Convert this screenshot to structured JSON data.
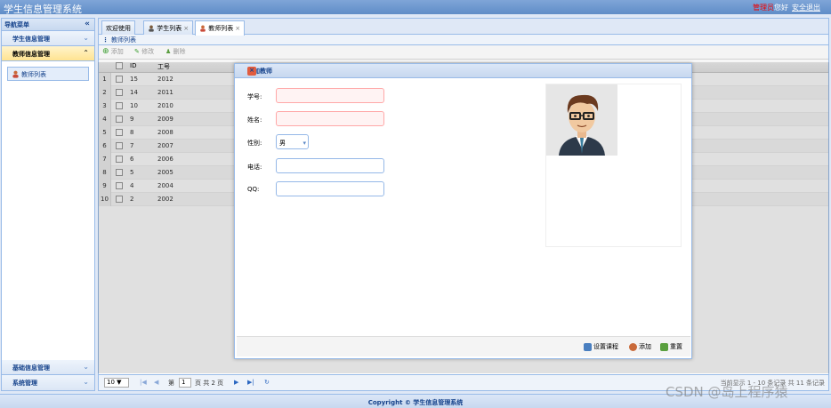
{
  "header": {
    "title": "学生信息管理系统",
    "admin": "管理员",
    "greeting": "您好",
    "logout": "安全退出"
  },
  "sidebar": {
    "title": "导航菜单",
    "collapse_icon": "«",
    "sections": [
      {
        "label": "学生信息管理"
      },
      {
        "label": "教师信息管理"
      }
    ],
    "active_item": "教师列表",
    "bottom_sections": [
      {
        "label": "基础信息管理"
      },
      {
        "label": "系统管理"
      }
    ]
  },
  "tabs": [
    {
      "label": "欢迎使用"
    },
    {
      "label": "学生列表",
      "close": "×"
    },
    {
      "label": "教师列表",
      "close": "×"
    }
  ],
  "panel": {
    "title": "教师列表"
  },
  "toolbar": {
    "add": "添加",
    "edit": "修改",
    "delete": "删除"
  },
  "grid": {
    "headers": [
      "ID",
      "工号"
    ],
    "rows": [
      {
        "n": "1",
        "id": "15",
        "no": "2012"
      },
      {
        "n": "2",
        "id": "14",
        "no": "2011"
      },
      {
        "n": "3",
        "id": "10",
        "no": "2010"
      },
      {
        "n": "4",
        "id": "9",
        "no": "2009"
      },
      {
        "n": "5",
        "id": "8",
        "no": "2008"
      },
      {
        "n": "6",
        "id": "7",
        "no": "2007"
      },
      {
        "n": "7",
        "id": "6",
        "no": "2006"
      },
      {
        "n": "8",
        "id": "5",
        "no": "2005"
      },
      {
        "n": "9",
        "id": "4",
        "no": "2004"
      },
      {
        "n": "10",
        "id": "2",
        "no": "2002"
      }
    ]
  },
  "pager": {
    "page_size": "10 ▼",
    "page_prefix": "第",
    "page_value": "1",
    "page_suffix": "页 共 2 页",
    "info": "当前显示 1 - 10 条记录 共 11 条记录"
  },
  "dialog": {
    "title": "添加教师",
    "fields": {
      "student_no": "学号:",
      "name": "姓名:",
      "gender": "性别:",
      "gender_value": "男",
      "phone": "电话:",
      "qq": "QQ:"
    },
    "buttons": {
      "set_course": "设置课程",
      "add": "添加",
      "reset": "重置"
    }
  },
  "footer": {
    "copyright": "Copyright © 学生信息管理系统"
  },
  "watermark": "CSDN @岛上程序猿"
}
